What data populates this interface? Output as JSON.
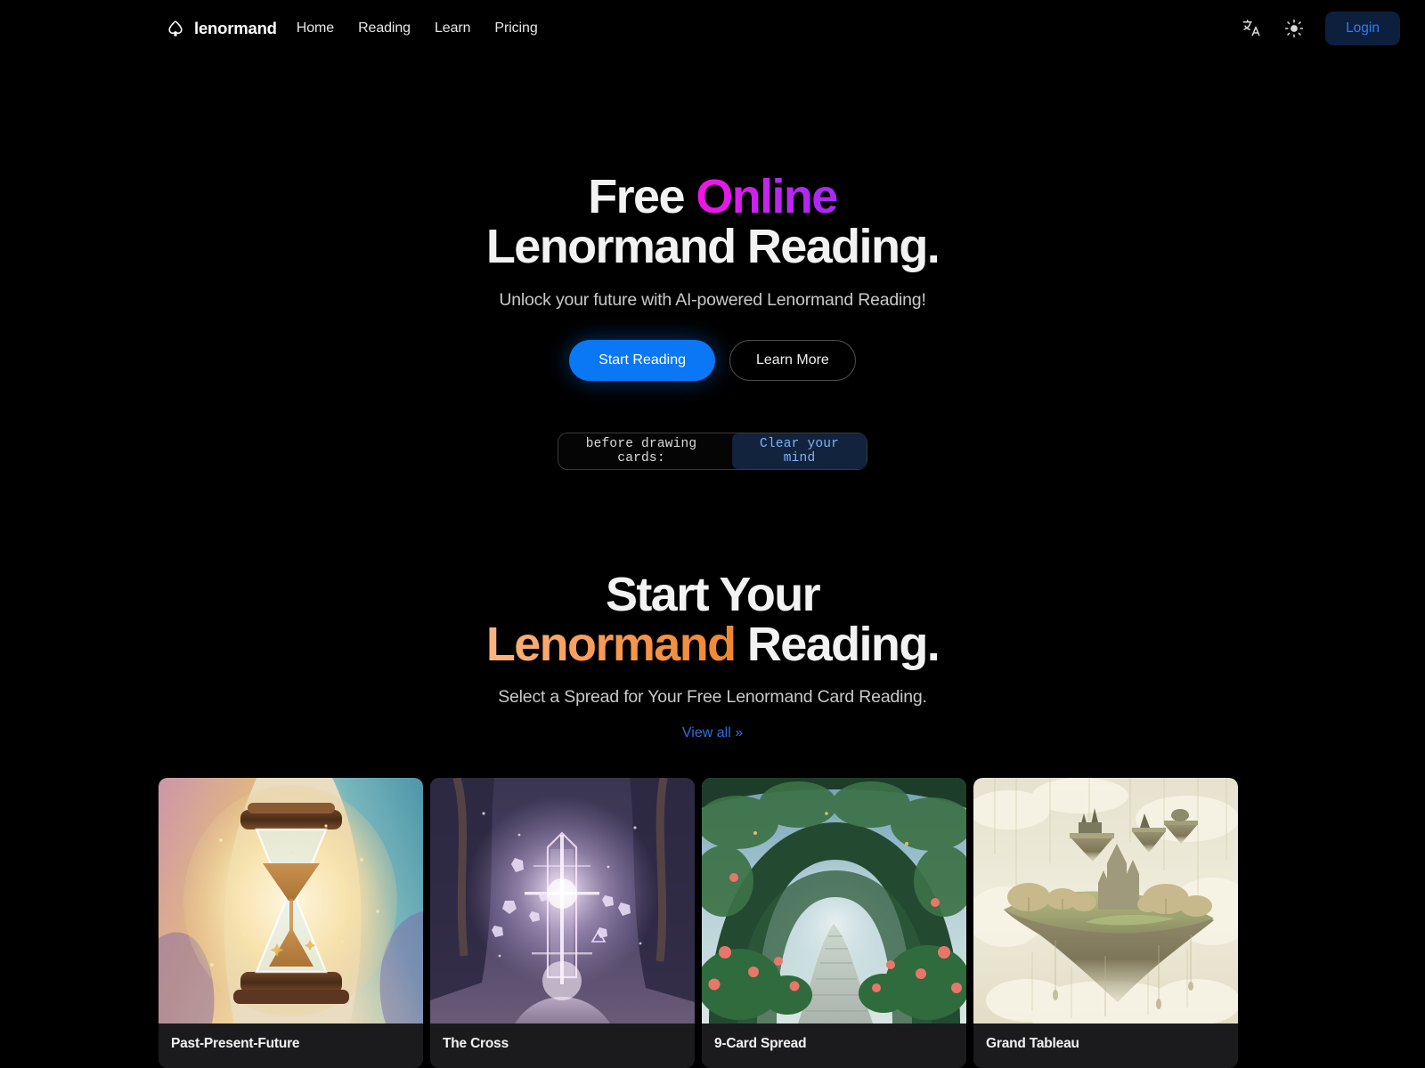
{
  "brand": {
    "name": "lenormand",
    "logo_icon": "spade-outline-icon"
  },
  "nav": {
    "links": [
      {
        "label": "Home"
      },
      {
        "label": "Reading"
      },
      {
        "label": "Learn"
      },
      {
        "label": "Pricing"
      }
    ],
    "language_icon": "translate-icon",
    "theme_icon": "sun-icon",
    "login_label": "Login",
    "login_bg": "#0c1f3d",
    "login_color": "#2f7cf6"
  },
  "hero": {
    "title_part1": "Free ",
    "title_highlight": "Online",
    "title_part2": "Lenormand Reading.",
    "highlight_gradient_from": "#f713e4",
    "highlight_gradient_to": "#a42bf5",
    "subtitle": "Unlock your future with AI-powered Lenormand Reading!",
    "primary_button": "Start Reading",
    "primary_button_color": "#0a77f5",
    "secondary_button": "Learn More",
    "terminal_prefix": "before drawing cards:",
    "terminal_pill": "Clear your mind",
    "terminal_pill_color": "#7fb3f5"
  },
  "spreads": {
    "title_line1": "Start Your",
    "title_highlight": "Lenormand",
    "title_rest": " Reading.",
    "highlight_gradient_from": "#fbb683",
    "highlight_gradient_to": "#f0872f",
    "subtitle": "Select a Spread for Your Free Lenormand Card Reading.",
    "view_all_label": "View all »",
    "view_all_color": "#2f6fe0",
    "cards": [
      {
        "title": "Past-Present-Future",
        "art": "hourglass-watercolor"
      },
      {
        "title": "The Cross",
        "art": "glowing-cross-forest"
      },
      {
        "title": "9-Card Spread",
        "art": "garden-arch-path"
      },
      {
        "title": "Grand Tableau",
        "art": "floating-islands-castle"
      }
    ]
  }
}
